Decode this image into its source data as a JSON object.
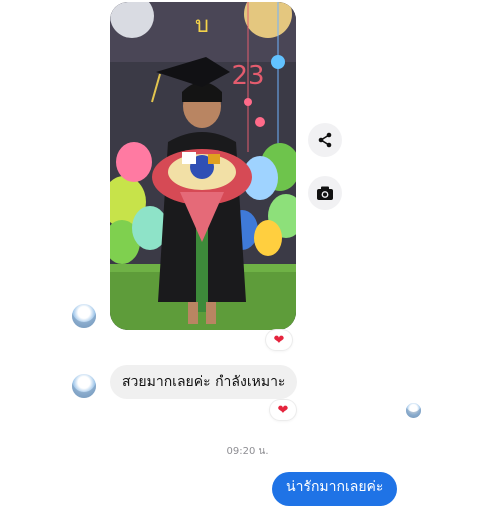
{
  "messages": {
    "incoming_text": "สวยมากเลยค่ะ กำลังเหมาะ",
    "outgoing_text": "น่ารักมากเลยค่ะ",
    "timestamp": "09:20 น.",
    "reaction_emoji": "❤"
  },
  "photo": {
    "banner_letter": "บ",
    "banner_digits": "23"
  },
  "icons": {
    "share": "share-icon",
    "camera": "camera-icon",
    "heart": "heart-icon"
  },
  "colors": {
    "outgoing_bubble": "#1f73e6",
    "incoming_bubble": "#f0f0f0",
    "heart": "#e5243d",
    "action_button": "#f1f1f3"
  }
}
